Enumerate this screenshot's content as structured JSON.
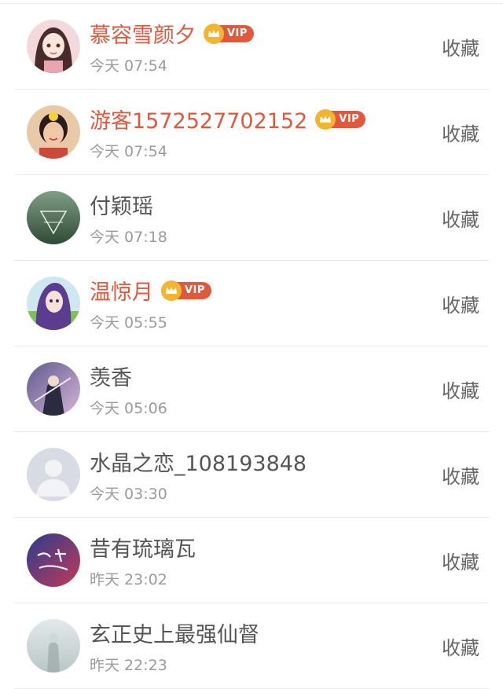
{
  "users": [
    {
      "name": "慕容雪颜夕",
      "vip": true,
      "vip_label": "VIP",
      "time": "今天 07:54",
      "action": "收藏",
      "avatar": "anime-girl-avatar-icon"
    },
    {
      "name": "游客1572527702152",
      "vip": true,
      "vip_label": "VIP",
      "time": "今天 07:54",
      "action": "收藏",
      "avatar": "girl-photo-avatar-icon"
    },
    {
      "name": "付颖瑶",
      "vip": false,
      "time": "今天 07:18",
      "action": "收藏",
      "avatar": "forest-triangle-avatar-icon"
    },
    {
      "name": "温惊月",
      "vip": true,
      "vip_label": "VIP",
      "time": "今天 05:55",
      "action": "收藏",
      "avatar": "anime-purple-hair-avatar-icon"
    },
    {
      "name": "羡香",
      "vip": false,
      "time": "今天 05:06",
      "action": "收藏",
      "avatar": "anime-warrior-avatar-icon"
    },
    {
      "name": "水晶之恋_108193848",
      "vip": false,
      "time": "今天 03:30",
      "action": "收藏",
      "avatar": "default-user-avatar-icon"
    },
    {
      "name": "昔有琉璃瓦",
      "vip": false,
      "time": "昨天 23:02",
      "action": "收藏",
      "avatar": "calligraphy-avatar-icon"
    },
    {
      "name": "玄正史上最强仙督",
      "vip": false,
      "time": "昨天 22:23",
      "action": "收藏",
      "avatar": "misty-figure-avatar-icon"
    }
  ],
  "colors": {
    "vip_name": "#e0593f",
    "normal_name": "#555555",
    "time": "#9b9b9b",
    "badge": "#e0593f",
    "crown": "#f1b52f"
  }
}
